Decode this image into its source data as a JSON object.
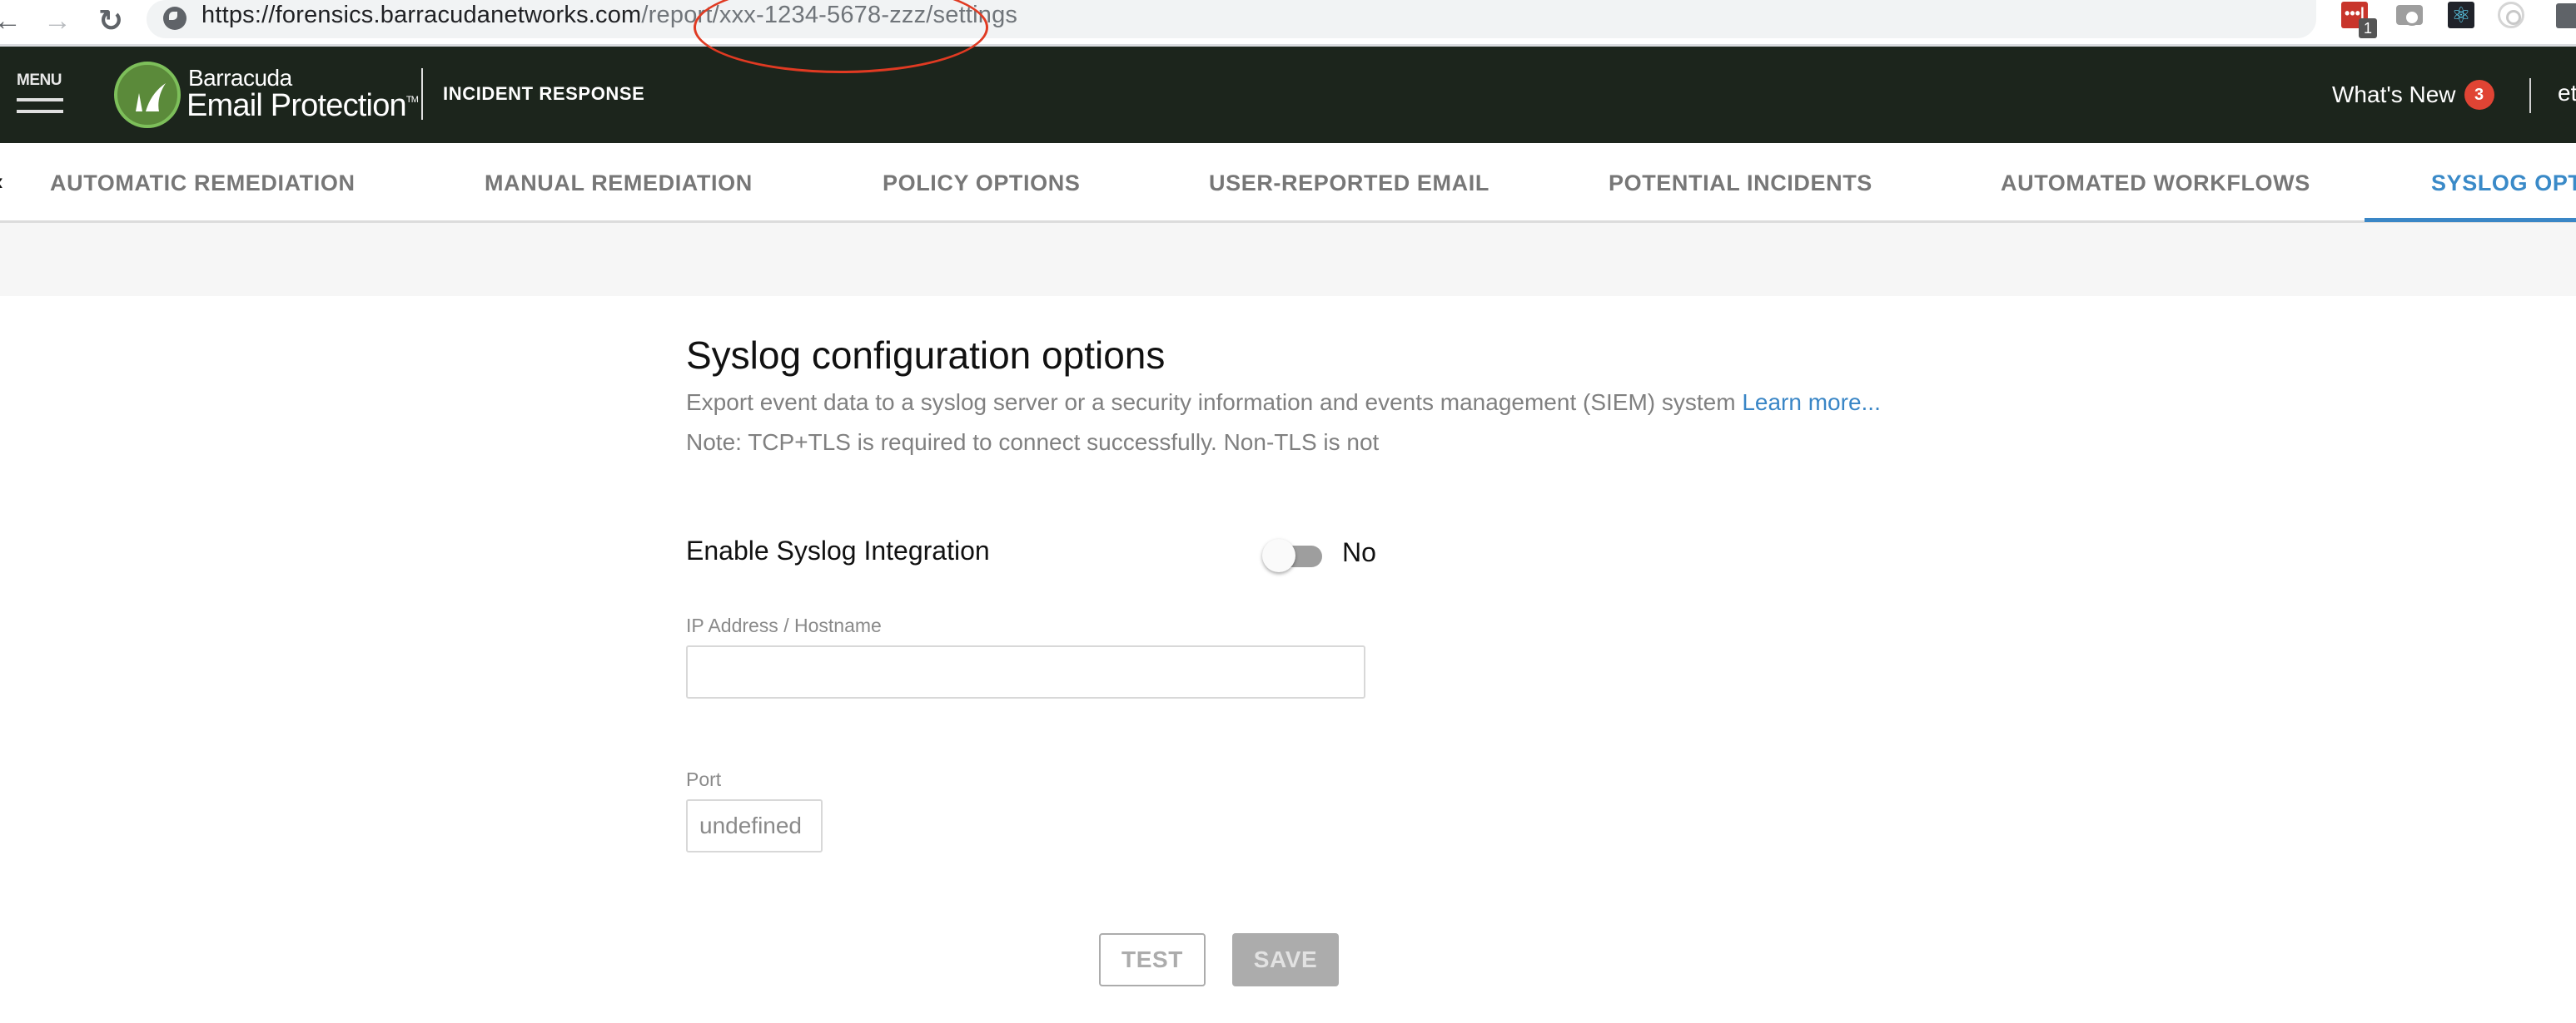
{
  "browser": {
    "url_host": "https://forensics.barracudanetworks.com",
    "url_path": "/report/xxx-1234-5678-zzz/settings",
    "extensions": [
      {
        "name": "lastpass",
        "glyph": "•••|",
        "badge": "1"
      },
      {
        "name": "camera",
        "glyph": ""
      },
      {
        "name": "react-devtools",
        "glyph": "⚛"
      },
      {
        "name": "target",
        "glyph": ""
      },
      {
        "name": "puzzle",
        "glyph": ""
      }
    ],
    "nav": {
      "back": "←",
      "forward": "→",
      "reload": "↻"
    }
  },
  "header": {
    "menu_label": "MENU",
    "brand_top": "Barracuda",
    "brand_main": "Email Protection",
    "brand_tm": "TM",
    "product": "INCIDENT RESPONSE",
    "whats_new": "What's New",
    "whats_new_count": "3",
    "user": "et"
  },
  "tabs": {
    "scroll_left": "‹",
    "items": [
      {
        "label": "AUTOMATIC REMEDIATION",
        "active": false
      },
      {
        "label": "MANUAL REMEDIATION",
        "active": false
      },
      {
        "label": "POLICY OPTIONS",
        "active": false
      },
      {
        "label": "USER-REPORTED EMAIL",
        "active": false
      },
      {
        "label": "POTENTIAL INCIDENTS",
        "active": false
      },
      {
        "label": "AUTOMATED WORKFLOWS",
        "active": false
      },
      {
        "label": "SYSLOG OPT",
        "active": true
      }
    ]
  },
  "content": {
    "title": "Syslog configuration options",
    "description": "Export event data to a syslog server or a security information and events management (SIEM) system ",
    "learn_more": "Learn more...",
    "note": "Note: TCP+TLS is required to connect successfully. Non-TLS is not",
    "enable_label": "Enable Syslog Integration",
    "enable_value": false,
    "enable_state_text": "No",
    "ip_label": "IP Address / Hostname",
    "ip_value": "",
    "port_label": "Port",
    "port_value": "undefined",
    "test_button": "TEST",
    "save_button": "SAVE"
  },
  "colors": {
    "header_bg": "#1c251c",
    "accent": "#3a86c6",
    "badge": "#e04434",
    "logo_green": "#5b8a3a",
    "annotation": "#e03a22"
  }
}
